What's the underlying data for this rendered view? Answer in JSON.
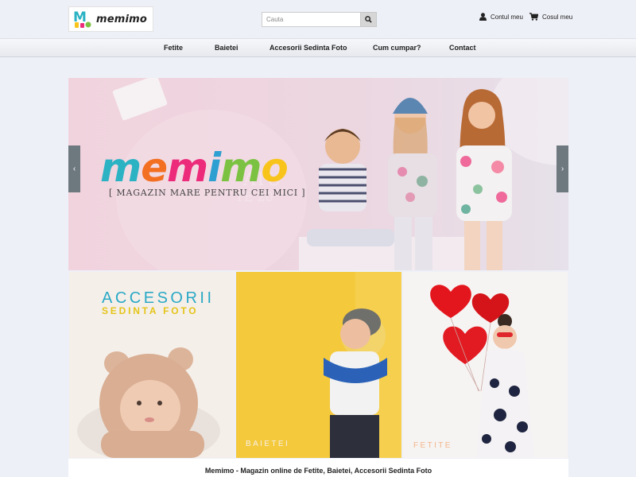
{
  "header": {
    "logo_text": "memimo",
    "search": {
      "placeholder": "Cauta"
    },
    "account_label": "Contul meu",
    "cart_label": "Cosul meu"
  },
  "nav": {
    "items": [
      {
        "label": "Fetite"
      },
      {
        "label": "Baietei"
      },
      {
        "label": "Accesorii Sedinta Foto"
      },
      {
        "label": "Cum cumpar?"
      },
      {
        "label": "Contact"
      }
    ]
  },
  "slider": {
    "brand_letters": [
      "m",
      "e",
      "m",
      "i",
      "m",
      "o"
    ],
    "tagline": "[ MAGAZIN MARE PENTRU CEI MICI ]",
    "prev_arrow": "‹",
    "next_arrow": "›"
  },
  "tiles": {
    "accessories_title": "ACCESORII",
    "accessories_subtitle": "SEDINTA FOTO",
    "boys_label": "BAIETEI",
    "girls_label": "FETITE"
  },
  "footer": {
    "caption": "Memimo - Magazin online de Fetite, Baietei, Accesorii Sedinta Foto"
  },
  "colors": {
    "page_bg": "#eef0f7",
    "brand_teal": "#2bb2c3",
    "brand_orange": "#f36f21",
    "brand_pink": "#ec2b7b",
    "brand_blue": "#2e9fd1",
    "brand_green": "#7cc242",
    "brand_yellow": "#f8c41c"
  }
}
